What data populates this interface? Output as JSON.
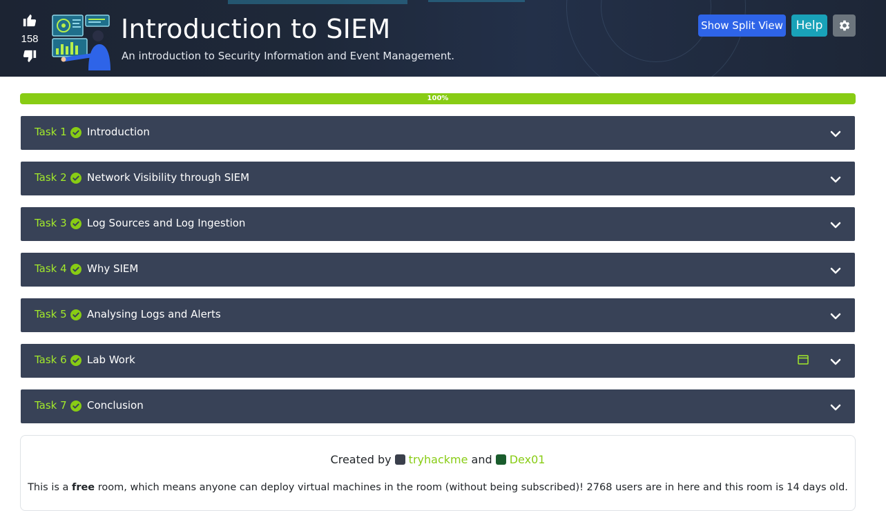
{
  "header": {
    "upvotes": "158",
    "title": "Introduction to SIEM",
    "subtitle": "An introduction to Security Information and Event Management.",
    "buttons": {
      "split_view": "Show Split View",
      "help": "Help"
    },
    "icons": {
      "upvote": "thumbs-up-icon",
      "downvote": "thumbs-down-icon",
      "settings": "gear-icon"
    }
  },
  "progress": {
    "label": "100%",
    "value": 100,
    "color": "#88cc14"
  },
  "tasks": [
    {
      "num": "Task 1",
      "name": "Introduction",
      "complete": true
    },
    {
      "num": "Task 2",
      "name": "Network Visibility through SIEM",
      "complete": true
    },
    {
      "num": "Task 3",
      "name": "Log Sources and Log Ingestion",
      "complete": true
    },
    {
      "num": "Task 4",
      "name": "Why SIEM",
      "complete": true
    },
    {
      "num": "Task 5",
      "name": "Analysing Logs and Alerts",
      "complete": true
    },
    {
      "num": "Task 6",
      "name": "Lab Work",
      "complete": true,
      "has_vm": true
    },
    {
      "num": "Task 7",
      "name": "Conclusion",
      "complete": true
    }
  ],
  "footer": {
    "created_by": "Created by",
    "and": "and",
    "creators": [
      "tryhackme",
      "Dex01"
    ],
    "desc_prefix": "This is a",
    "desc_bold": "free",
    "desc_suffix": "room, which means anyone can deploy virtual machines in the room (without being subscribed)! 2768 users are in here and this room is 14 days old."
  },
  "colors": {
    "accent": "#88cc14",
    "task_bg": "#384257",
    "task_num": "#a3ea2a",
    "split_btn": "#2e64e8",
    "help_btn": "#19a2b8",
    "gear_btn": "#6c757d"
  }
}
